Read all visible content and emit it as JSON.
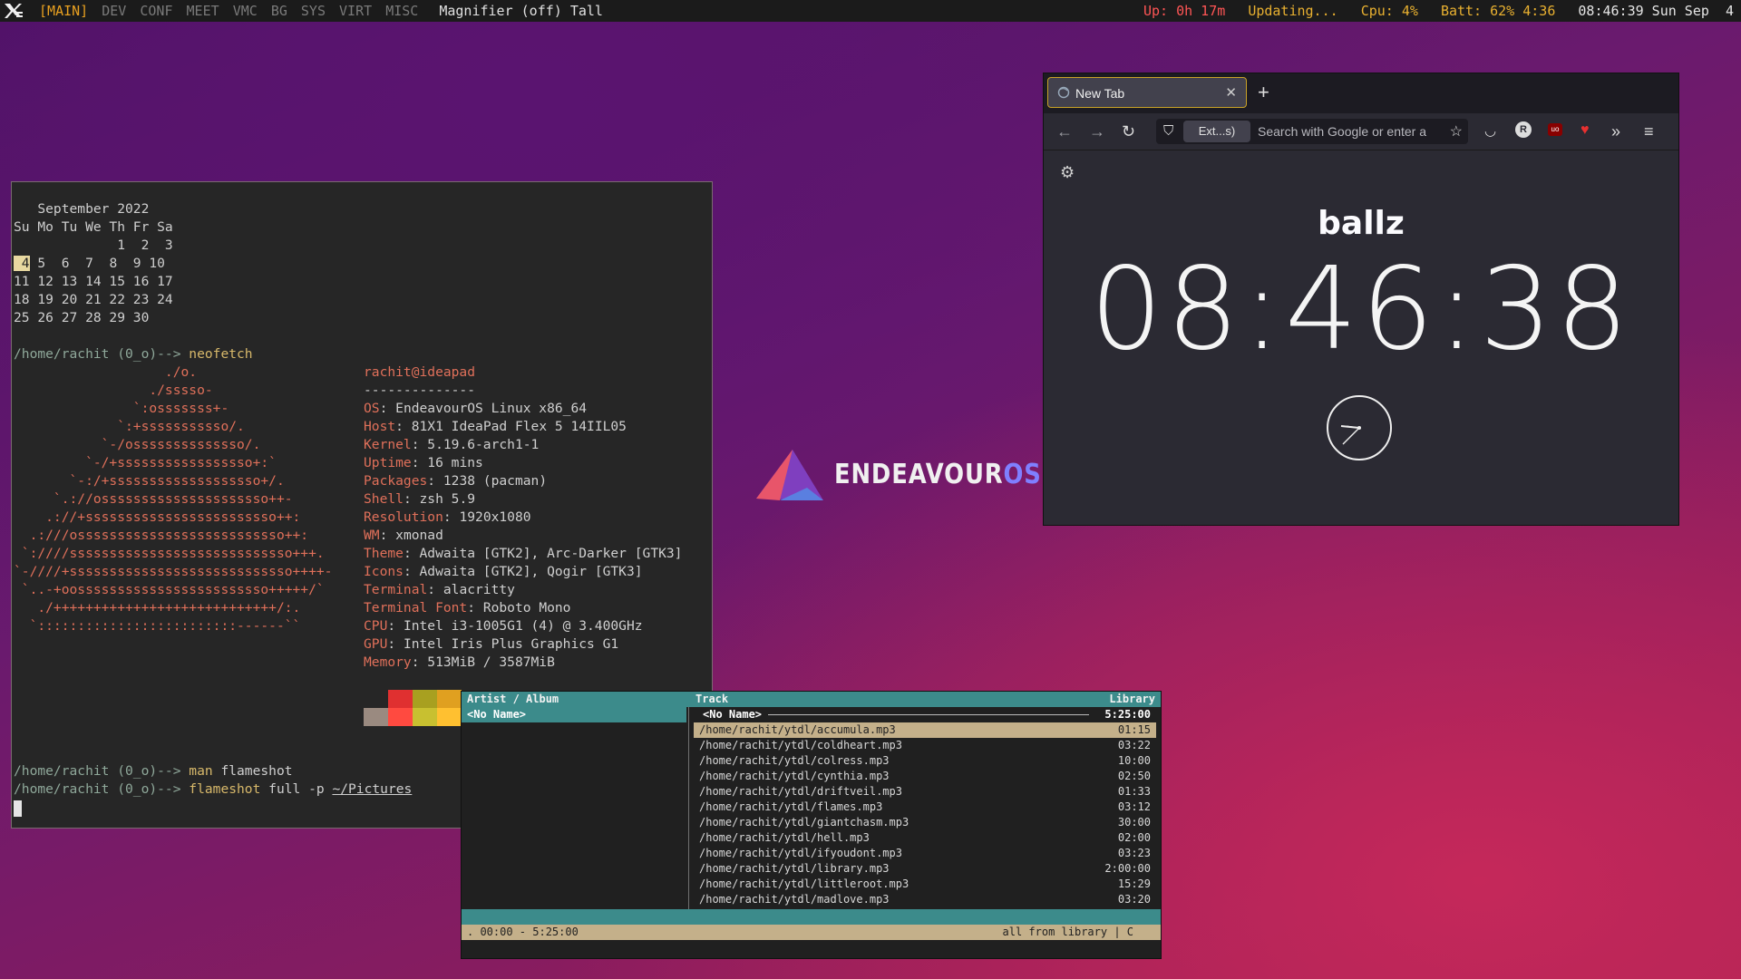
{
  "topbar": {
    "workspace_active": "[MAIN]",
    "workspaces": [
      "DEV",
      "CONF",
      "MEET",
      "VMC",
      "BG",
      "SYS",
      "VIRT",
      "MISC"
    ],
    "layout": "Magnifier (off) Tall",
    "uptime": "Up: 0h 17m",
    "updates": "Updating...",
    "cpu": "Cpu: 4%",
    "battery": "Batt: 62% 4:36",
    "datetime": "08:46:39 Sun Sep  4"
  },
  "terminal": {
    "cal_title": "   September 2022",
    "cal_head": "Su Mo Tu We Th Fr Sa",
    "cal_rows": [
      "             1  2  3",
      " 5  6  7  8  9 10",
      "11 12 13 14 15 16 17",
      "18 19 20 21 22 23 24",
      "25 26 27 28 29 30"
    ],
    "cal_today": " 4",
    "prompt": "/home/rachit (0_o)--> ",
    "cmd1": "neofetch",
    "cmd2_a": "man",
    "cmd2_b": " flameshot",
    "cmd3_a": "flameshot",
    "cmd3_b": " full -p ",
    "cmd3_c": "~/Pictures",
    "art": [
      "                   ./o.",
      "                 ./sssso-",
      "               `:osssssss+-",
      "             `:+sssssssssso/.",
      "           `-/ossssssssssssso/.",
      "         `-/+sssssssssssssssso+:`",
      "       `-:/+sssssssssssssssssso+/.",
      "     `.://osssssssssssssssssssso++-",
      "    .://+ssssssssssssssssssssssso++:",
      "  .:///ossssssssssssssssssssssssso++:",
      " `:////ssssssssssssssssssssssssssso+++.",
      "`-////+ssssssssssssssssssssssssssso++++-",
      " `..-+oossssssssssssssssssssssso+++++/`",
      "   ./++++++++++++++++++++++++++++/:.",
      "  `:::::::::::::::::::::::::------``"
    ],
    "userhost": "rachit@ideapad",
    "sep": "--------------",
    "info": [
      {
        "k": "OS",
        "v": " EndeavourOS Linux x86_64"
      },
      {
        "k": "Host",
        "v": " 81X1 IdeaPad Flex 5 14IIL05"
      },
      {
        "k": "Kernel",
        "v": " 5.19.6-arch1-1"
      },
      {
        "k": "Uptime",
        "v": " 16 mins"
      },
      {
        "k": "Packages",
        "v": " 1238 (pacman)"
      },
      {
        "k": "Shell",
        "v": " zsh 5.9"
      },
      {
        "k": "Resolution",
        "v": " 1920x1080"
      },
      {
        "k": "WM",
        "v": " xmonad"
      },
      {
        "k": "Theme",
        "v": " Adwaita [GTK2], Arc-Darker [GTK3]"
      },
      {
        "k": "Icons",
        "v": " Adwaita [GTK2], Qogir [GTK3]"
      },
      {
        "k": "Terminal",
        "v": " alacritty"
      },
      {
        "k": "Terminal Font",
        "v": " Roboto Mono"
      },
      {
        "k": "CPU",
        "v": " Intel i3-1005G1 (4) @ 3.400GHz"
      },
      {
        "k": "GPU",
        "v": " Intel Iris Plus Graphics G1"
      },
      {
        "k": "Memory",
        "v": " 513MiB / 3587MiB"
      }
    ],
    "colors_top": [
      "#262626",
      "#e03030",
      "#a8a020",
      "#e0a020"
    ],
    "colors_bottom": [
      "#9a8a80",
      "#ff4a40",
      "#c8c030",
      "#ffc030"
    ]
  },
  "firefox": {
    "tab_title": "New Tab",
    "tab_close": "✕",
    "new_tab": "+",
    "ext_label": "Ext...s)",
    "url_placeholder": "Search with Google or enter a",
    "page_title": "ballz",
    "clock": "08:46:38"
  },
  "logo": {
    "main": "ENDEAVOUR",
    "suffix": "OS"
  },
  "music": {
    "col_artist": "Artist / Album",
    "col_track": "Track",
    "col_library": "Library",
    "left_selected": "<No Name>",
    "album_name": "<No Name>",
    "album_duration": "5:25:00",
    "tracks": [
      {
        "path": "/home/rachit/ytdl/accumula.mp3",
        "dur": "01:15"
      },
      {
        "path": "/home/rachit/ytdl/coldheart.mp3",
        "dur": "03:22"
      },
      {
        "path": "/home/rachit/ytdl/colress.mp3",
        "dur": "10:00"
      },
      {
        "path": "/home/rachit/ytdl/cynthia.mp3",
        "dur": "02:50"
      },
      {
        "path": "/home/rachit/ytdl/driftveil.mp3",
        "dur": "01:33"
      },
      {
        "path": "/home/rachit/ytdl/flames.mp3",
        "dur": "03:12"
      },
      {
        "path": "/home/rachit/ytdl/giantchasm.mp3",
        "dur": "30:00"
      },
      {
        "path": "/home/rachit/ytdl/hell.mp3",
        "dur": "02:00"
      },
      {
        "path": "/home/rachit/ytdl/ifyoudont.mp3",
        "dur": "03:23"
      },
      {
        "path": "/home/rachit/ytdl/library.mp3",
        "dur": "2:00:00"
      },
      {
        "path": "/home/rachit/ytdl/littleroot.mp3",
        "dur": "15:29"
      },
      {
        "path": "/home/rachit/ytdl/madlove.mp3",
        "dur": "03:20"
      }
    ],
    "status_left": ". 00:00 - 5:25:00",
    "status_right": "all from library | C"
  }
}
